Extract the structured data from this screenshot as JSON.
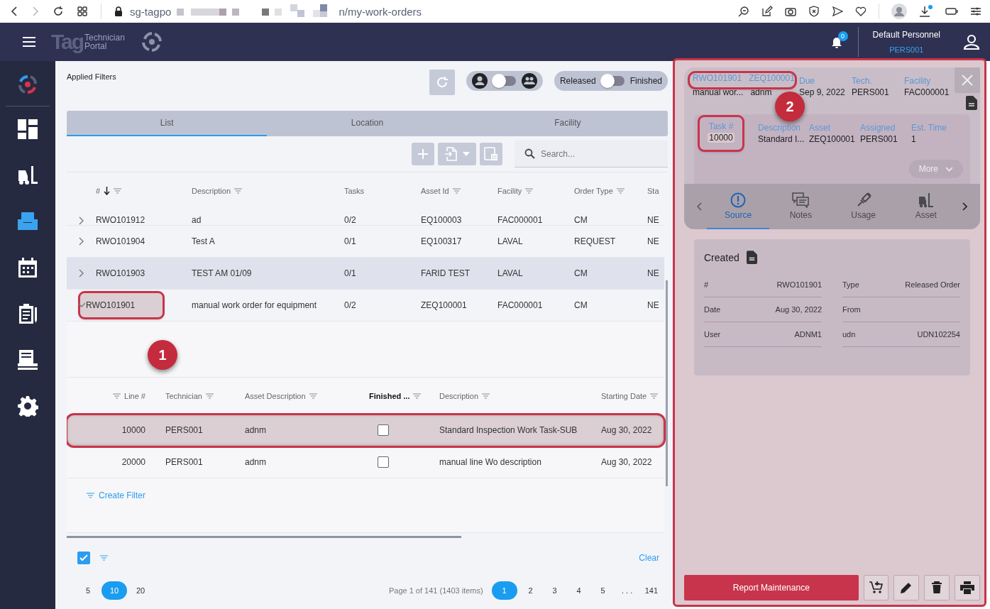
{
  "browser": {
    "url_start": "sg-tagpo",
    "url_end": "n/my-work-orders"
  },
  "header": {
    "logo": "Tag",
    "product_line1": "Technician",
    "product_line2": "Portal",
    "notifications": "0",
    "user_name": "Default Personnel",
    "user_id": "PERS001"
  },
  "sidebar": {
    "items": [
      {
        "kind": "dashboard",
        "selected": false
      },
      {
        "kind": "forklift",
        "selected": false
      },
      {
        "kind": "tray",
        "selected": true
      },
      {
        "kind": "calendar",
        "selected": false
      },
      {
        "kind": "clipboard",
        "selected": false
      },
      {
        "kind": "receipt",
        "selected": false
      },
      {
        "kind": "settings",
        "selected": false
      }
    ]
  },
  "filters": {
    "label": "Applied Filters",
    "scope_toggle": {
      "on": false
    },
    "status_toggle": {
      "off_label": "Released",
      "on_label": "Finished",
      "on": false
    }
  },
  "tabs": [
    {
      "label": "List",
      "selected": true
    },
    {
      "label": "Location",
      "selected": false
    },
    {
      "label": "Facility",
      "selected": false
    }
  ],
  "search": {
    "placeholder": "Search..."
  },
  "table": {
    "columns": [
      {
        "label": "#",
        "sorted": true,
        "filter": true
      },
      {
        "label": "Description",
        "sorted": false,
        "filter": true
      },
      {
        "label": "Tasks",
        "sorted": false,
        "filter": false
      },
      {
        "label": "Asset Id",
        "sorted": false,
        "filter": true
      },
      {
        "label": "Facility",
        "sorted": false,
        "filter": true
      },
      {
        "label": "Order Type",
        "sorted": false,
        "filter": true
      },
      {
        "label": "Sta",
        "sorted": false,
        "filter": false
      }
    ],
    "rows": [
      {
        "cells": [
          "RWO101912",
          "ad",
          "0/2",
          "EQ100003",
          "FAC000001",
          "CM",
          "NE"
        ],
        "expanded": false,
        "selected": false,
        "annotated": false
      },
      {
        "cells": [
          "RWO101904",
          "Test A",
          "0/1",
          "EQ100317",
          "LAVAL",
          "REQUEST",
          "NE"
        ],
        "expanded": false,
        "selected": false,
        "annotated": false
      },
      {
        "cells": [
          "RWO101903",
          "TEST AM 01/09",
          "0/1",
          "FARID TEST",
          "LAVAL",
          "CM",
          "NE"
        ],
        "expanded": false,
        "selected": true,
        "annotated": false
      },
      {
        "cells": [
          "RWO101901",
          "manual work order for equipment",
          "0/2",
          "ZEQ100001",
          "FAC000001",
          "CM",
          "NE"
        ],
        "expanded": true,
        "selected": false,
        "annotated": true,
        "tasks": {
          "columns": [
            {
              "label": "Line #",
              "active": false
            },
            {
              "label": "Technician",
              "active": false
            },
            {
              "label": "Asset Description",
              "active": false
            },
            {
              "label": "Finished ...",
              "active": true
            },
            {
              "label": "Description",
              "active": false
            },
            {
              "label": "Starting Date",
              "active": false
            }
          ],
          "rows": [
            {
              "line": "10000",
              "technician": "PERS001",
              "asset_description": "adnm",
              "finished": false,
              "description": "Standard Inspection Work Task-SUB",
              "starting_date": "Aug 30, 2022",
              "selected": true,
              "annotated": true
            },
            {
              "line": "20000",
              "technician": "PERS001",
              "asset_description": "adnm",
              "finished": false,
              "description": "manual line Wo description",
              "starting_date": "Aug 30, 2022",
              "selected": false,
              "annotated": false
            }
          ],
          "create_filter": "Create Filter"
        }
      }
    ]
  },
  "footer": {
    "select_all": true,
    "clear": "Clear",
    "page_sizes": [
      {
        "label": "5",
        "selected": false
      },
      {
        "label": "10",
        "selected": true
      },
      {
        "label": "20",
        "selected": false
      }
    ],
    "page_info": "Page 1 of 141 (1403 items)",
    "pages": [
      {
        "label": "1",
        "selected": true
      },
      {
        "label": "2",
        "selected": false
      },
      {
        "label": "3",
        "selected": false
      },
      {
        "label": "4",
        "selected": false
      },
      {
        "label": "5",
        "selected": false
      },
      {
        "label": ". . .",
        "selected": false
      },
      {
        "label": "141",
        "selected": false
      }
    ]
  },
  "detail": {
    "order": "RWO101901",
    "asset": "ZEQ100001",
    "order_description": "manual wor...",
    "asset_description": "adnm",
    "annotated": true,
    "fields": [
      {
        "label": "Due",
        "value": "Sep 9, 2022"
      },
      {
        "label": "Tech.",
        "value": "PERS001"
      },
      {
        "label": "Facility",
        "value": "FAC000001"
      }
    ],
    "task": {
      "fields": [
        {
          "label": "Task #",
          "value": "10000",
          "annotated": true
        },
        {
          "label": "Description",
          "value": "Standard I...",
          "annotated": false
        },
        {
          "label": "Asset",
          "value": "ZEQ100001",
          "annotated": false
        },
        {
          "label": "Assigned",
          "value": "PERS001",
          "annotated": false
        },
        {
          "label": "Est. Time",
          "value": "1",
          "annotated": false
        }
      ],
      "more": "More"
    },
    "tabs": [
      {
        "label": "Source",
        "kind": "source",
        "selected": true
      },
      {
        "label": "Notes",
        "kind": "notes",
        "selected": false
      },
      {
        "label": "Usage",
        "kind": "usage",
        "selected": false
      },
      {
        "label": "Asset",
        "kind": "asset",
        "selected": false
      }
    ],
    "created": {
      "title": "Created",
      "fields": [
        {
          "label": "#",
          "value": "RWO101901"
        },
        {
          "label": "Type",
          "value": "Released Order"
        },
        {
          "label": "Date",
          "value": "Aug 30, 2022"
        },
        {
          "label": "From"
        },
        {
          "label": "User",
          "value": "ADNM1"
        },
        {
          "label": "udn",
          "value": "UDN102254"
        }
      ]
    },
    "report_button": "Report Maintenance"
  },
  "callouts": [
    {
      "label": "1"
    },
    {
      "label": "2"
    }
  ]
}
